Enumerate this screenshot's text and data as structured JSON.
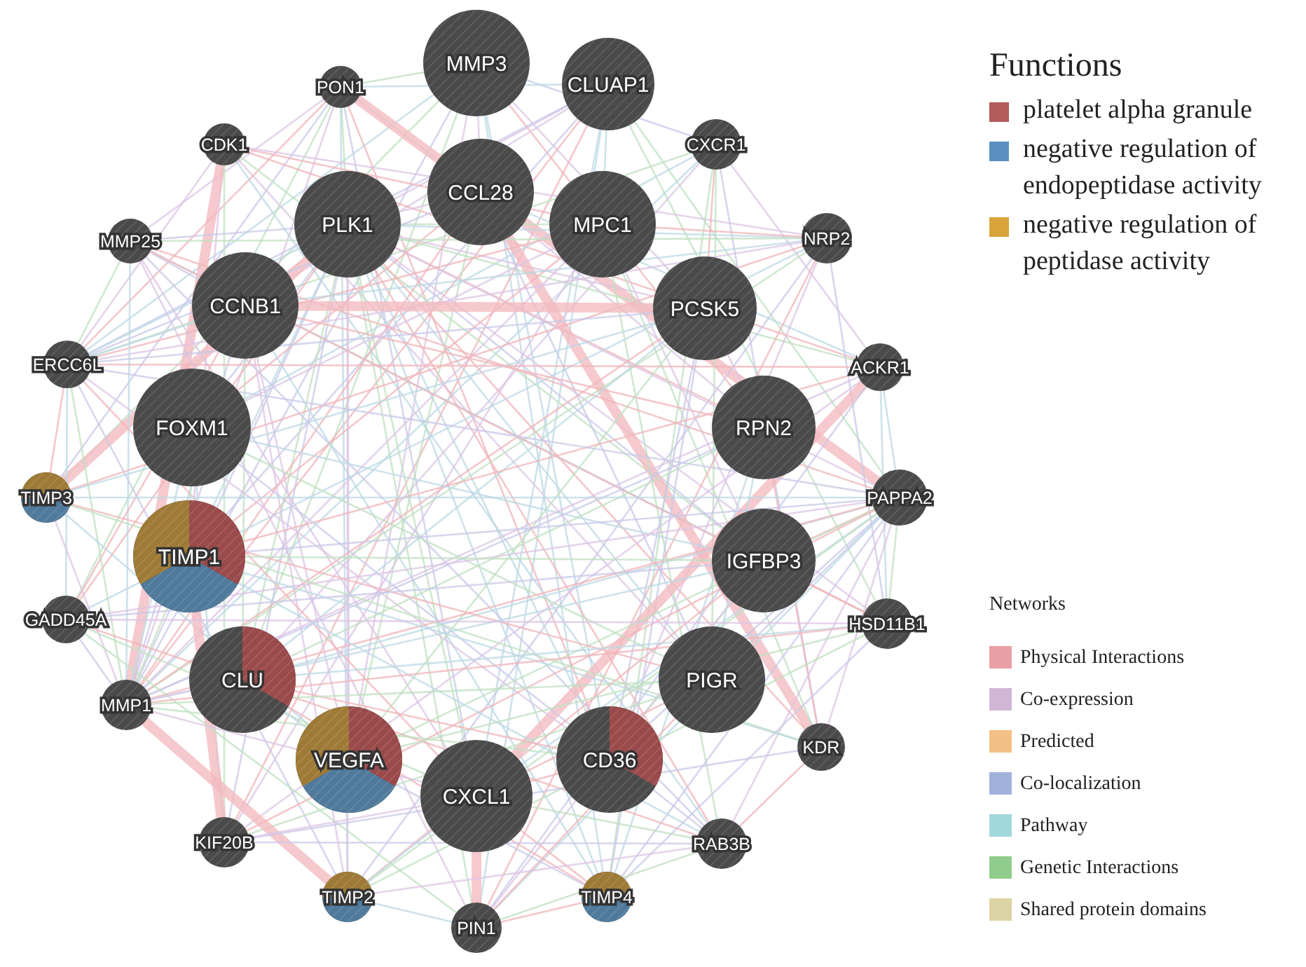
{
  "nodes": [
    {
      "label": "MMP3",
      "kind": "large",
      "in_functions": [
        false,
        false,
        false
      ]
    },
    {
      "label": "CLUAP1",
      "kind": "large",
      "in_functions": [
        false,
        false,
        false
      ]
    },
    {
      "label": "PON1",
      "kind": "small",
      "in_functions": [
        false,
        false,
        false
      ]
    },
    {
      "label": "CDK1",
      "kind": "small",
      "in_functions": [
        false,
        false,
        false
      ]
    },
    {
      "label": "CXCR1",
      "kind": "small",
      "in_functions": [
        false,
        false,
        false
      ]
    },
    {
      "label": "PLK1",
      "kind": "large",
      "in_functions": [
        false,
        false,
        false
      ]
    },
    {
      "label": "CCL28",
      "kind": "large",
      "in_functions": [
        false,
        false,
        false
      ]
    },
    {
      "label": "MPC1",
      "kind": "large",
      "in_functions": [
        false,
        false,
        false
      ]
    },
    {
      "label": "NRP2",
      "kind": "small",
      "in_functions": [
        false,
        false,
        false
      ]
    },
    {
      "label": "MMP25",
      "kind": "small",
      "in_functions": [
        false,
        false,
        false
      ]
    },
    {
      "label": "CCNB1",
      "kind": "large",
      "in_functions": [
        false,
        false,
        false
      ]
    },
    {
      "label": "PCSK5",
      "kind": "large",
      "in_functions": [
        false,
        false,
        false
      ]
    },
    {
      "label": "ACKR1",
      "kind": "small",
      "in_functions": [
        false,
        false,
        false
      ]
    },
    {
      "label": "ERCC6L",
      "kind": "small",
      "in_functions": [
        false,
        false,
        false
      ]
    },
    {
      "label": "FOXM1",
      "kind": "large",
      "in_functions": [
        false,
        false,
        false
      ]
    },
    {
      "label": "RPN2",
      "kind": "large",
      "in_functions": [
        false,
        false,
        false
      ]
    },
    {
      "label": "PAPPA2",
      "kind": "small",
      "in_functions": [
        false,
        false,
        false
      ]
    },
    {
      "label": "TIMP3",
      "kind": "small",
      "in_functions": [
        false,
        true,
        true
      ]
    },
    {
      "label": "TIMP1",
      "kind": "large",
      "in_functions": [
        true,
        true,
        true
      ]
    },
    {
      "label": "IGFBP3",
      "kind": "large",
      "in_functions": [
        false,
        false,
        false
      ]
    },
    {
      "label": "GADD45A",
      "kind": "small",
      "in_functions": [
        false,
        false,
        false
      ]
    },
    {
      "label": "HSD11B1",
      "kind": "small",
      "in_functions": [
        false,
        false,
        false
      ]
    },
    {
      "label": "CLU",
      "kind": "large",
      "in_functions": [
        true,
        false,
        false
      ]
    },
    {
      "label": "PIGR",
      "kind": "large",
      "in_functions": [
        false,
        false,
        false
      ]
    },
    {
      "label": "MMP1",
      "kind": "small",
      "in_functions": [
        false,
        false,
        false
      ]
    },
    {
      "label": "KDR",
      "kind": "small",
      "in_functions": [
        false,
        false,
        false
      ]
    },
    {
      "label": "VEGFA",
      "kind": "large",
      "in_functions": [
        true,
        true,
        true
      ]
    },
    {
      "label": "CXCL1",
      "kind": "large",
      "in_functions": [
        false,
        false,
        false
      ]
    },
    {
      "label": "CD36",
      "kind": "large",
      "in_functions": [
        true,
        false,
        false
      ]
    },
    {
      "label": "KIF20B",
      "kind": "small",
      "in_functions": [
        false,
        false,
        false
      ]
    },
    {
      "label": "RAB3B",
      "kind": "small",
      "in_functions": [
        false,
        false,
        false
      ]
    },
    {
      "label": "TIMP2",
      "kind": "small",
      "in_functions": [
        false,
        true,
        true
      ]
    },
    {
      "label": "PIN1",
      "kind": "small",
      "in_functions": [
        false,
        false,
        false
      ]
    },
    {
      "label": "TIMP4",
      "kind": "small",
      "in_functions": [
        false,
        true,
        true
      ]
    }
  ],
  "functions": {
    "title": "Functions",
    "items": [
      {
        "label": "platelet alpha granule",
        "color": "#b35a5a"
      },
      {
        "label": "negative regulation of endopeptidase activity",
        "color": "#5a8fbf"
      },
      {
        "label": "negative regulation of peptidase activity",
        "color": "#d9a53a"
      }
    ]
  },
  "networks": {
    "title": "Networks",
    "items": [
      {
        "label": "Physical Interactions",
        "color": "#e8a0a4"
      },
      {
        "label": "Co-expression",
        "color": "#d2b6d8"
      },
      {
        "label": "Predicted",
        "color": "#f2c084"
      },
      {
        "label": "Co-localization",
        "color": "#a0b2dc"
      },
      {
        "label": "Pathway",
        "color": "#a0d8dc"
      },
      {
        "label": "Genetic Interactions",
        "color": "#90cc8c"
      },
      {
        "label": "Shared protein domains",
        "color": "#dcd4a4"
      }
    ]
  }
}
